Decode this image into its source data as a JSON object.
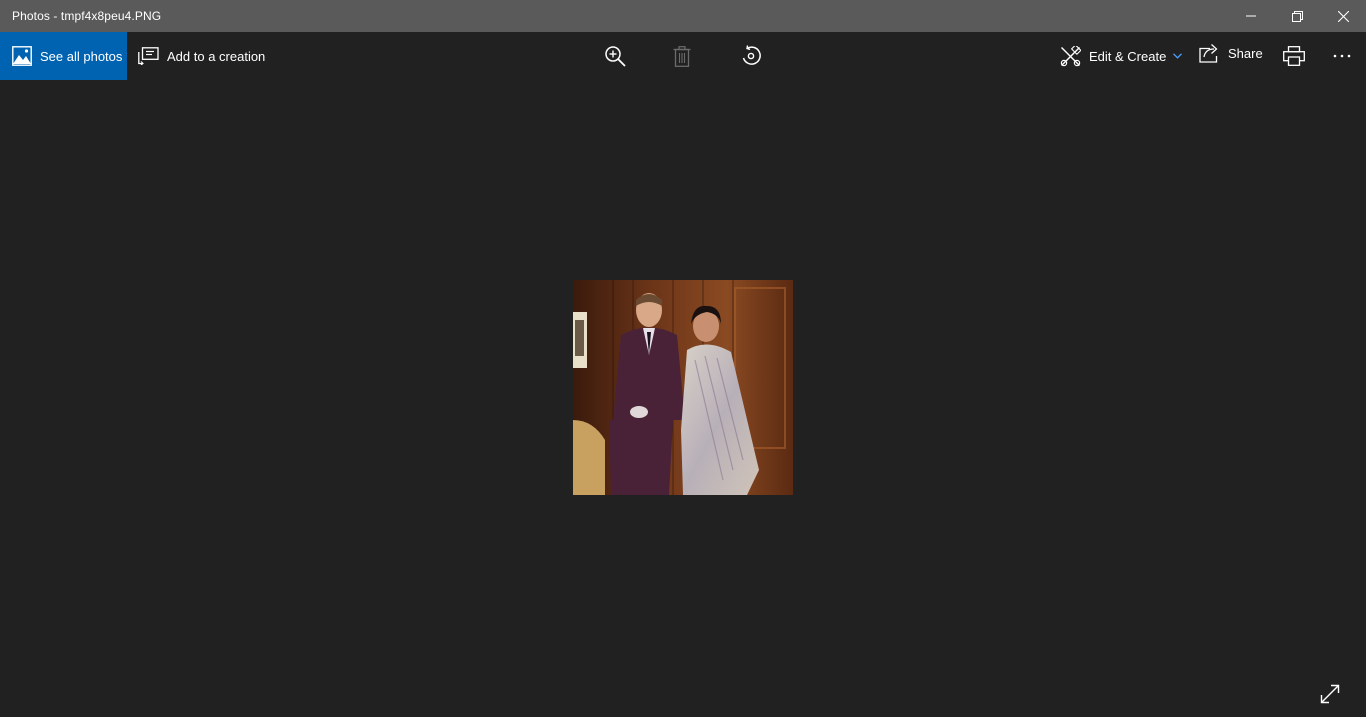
{
  "window": {
    "title": "Photos - tmpf4x8peu4.PNG"
  },
  "toolbar": {
    "see_all_label": "See all photos",
    "add_creation_label": "Add to a creation",
    "edit_create_label": "Edit & Create",
    "share_label": "Share",
    "icons": [
      "zoom-in-icon",
      "delete-icon",
      "rotate-icon",
      "print-icon",
      "more-icon"
    ]
  },
  "colors": {
    "titlebar": "#5a5a5a",
    "background": "#212121",
    "accent": "#0063b1"
  }
}
